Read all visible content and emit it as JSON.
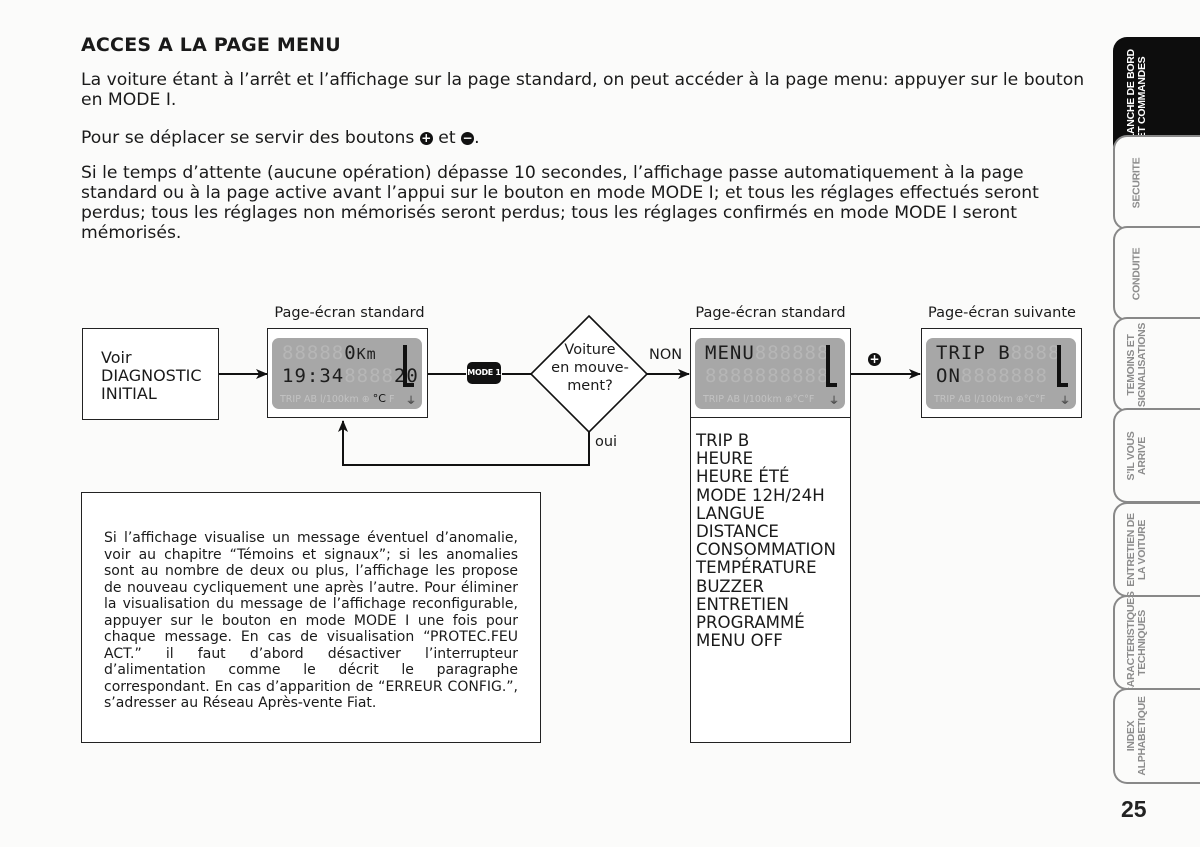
{
  "heading": "ACCES A LA PAGE MENU",
  "paragraphs": {
    "p1": "La voiture étant à l’arrêt et l’affichage sur la page standard, on peut accéder à la page menu: appuyer sur le bouton en MODE I.",
    "p2_before": "Pour se déplacer se servir des boutons",
    "p2_mid": "et",
    "p2_end": ".",
    "p3": "Si le temps d’attente (aucune opération) dépasse 10 secondes, l’affichage passe automatiquement à la page standard ou à la page active avant l’appui sur le bouton en mode MODE I; et tous les réglages effectués seront perdus; tous les réglages non mémorisés seront perdus; tous les réglages confirmés en mode MODE I seront mémorisés."
  },
  "icons": {
    "plus": "+",
    "minus": "−"
  },
  "diagram": {
    "start_box": [
      "Voir",
      "DIAGNOSTIC",
      "INITIAL"
    ],
    "screen1": {
      "caption": "Page-écran standard",
      "row1_ghost": "88888",
      "row1_value": "0",
      "row1_unit": "Km",
      "row2_value": "19:34",
      "row2_ghost": "8888",
      "row2_value2": "20",
      "footer_ghost": "TRIP AB l/100km ⊕",
      "footer_unit": "°C",
      "footer_tail": "F"
    },
    "mode_button": "MODE 1",
    "decision": {
      "text": [
        "Voiture",
        "en mouve-",
        "ment?"
      ],
      "no_label": "NON",
      "yes_label": "oui"
    },
    "screen2": {
      "caption": "Page-écran standard",
      "row1_value": "MENU",
      "row1_ghost": "888888",
      "row2_ghost": "8888888888",
      "footer": "TRIP AB l/100km ⊕°C°F"
    },
    "plus_label": "+",
    "screen3": {
      "caption": "Page-écran suivante",
      "row1_value": "TRIP B",
      "row1_ghost": "8888",
      "row2_value": "ON",
      "row2_ghost": "8888888",
      "footer": "TRIP AB l/100km ⊕°C°F"
    },
    "menu_items": [
      "TRIP B",
      "HEURE",
      "HEURE ÉTÉ",
      "MODE 12H/24H",
      "LANGUE",
      "DISTANCE",
      "CONSOMMATION",
      "TEMPÉRATURE",
      "BUZZER",
      "ENTRETIEN",
      "PROGRAMMÉ",
      "MENU OFF"
    ]
  },
  "note": "Si l’affichage visualise un message éventuel d’anomalie, voir au chapitre “Témoins et signaux”; si les anomalies sont au nombre de deux ou plus, l’affichage les propose de nouveau cycliquement une après l’autre. Pour éliminer la visualisation du message de l’affichage reconfigurable, appuyer sur le bouton en mode MODE I une fois pour chaque message. En cas de visualisation “PROTEC.FEU ACT.” il faut d’abord désactiver l’interrupteur d’alimentation comme le décrit le paragraphe correspondant. En cas d’apparition de “ERREUR CONFIG.”, s’adresser au Réseau Après-vente Fiat.",
  "side_tabs": [
    {
      "label1": "PLANCHE DE BORD",
      "label2": "ET COMMANDES",
      "active": true
    },
    {
      "label1": "SECURITE",
      "label2": "",
      "active": false
    },
    {
      "label1": "CONDUITE",
      "label2": "",
      "active": false
    },
    {
      "label1": "TEMOINS ET",
      "label2": "SIGNALISATIONS",
      "active": false
    },
    {
      "label1": "S’IL VOUS",
      "label2": "ARRIVE",
      "active": false
    },
    {
      "label1": "ENTRETIEN DE",
      "label2": "LA VOITURE",
      "active": false
    },
    {
      "label1": "CARACTERISTIQUES",
      "label2": "TECHNIQUES",
      "active": false
    },
    {
      "label1": "INDEX",
      "label2": "ALPHABETIQUE",
      "active": false
    }
  ],
  "page_number": "25"
}
